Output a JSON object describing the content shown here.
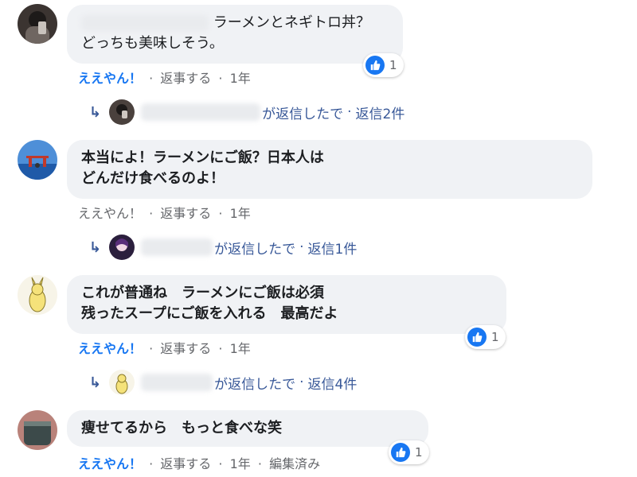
{
  "comments": [
    {
      "lines": [
        "ラーメンとネギトロ丼？",
        "どっちも美味しそう。"
      ],
      "actions": {
        "like": "ええやん！",
        "reply": "返事する",
        "time": "1年"
      },
      "reaction_count": "1",
      "replies": {
        "text": "が返信したで",
        "count": "返信2件"
      }
    },
    {
      "lines": [
        "本当によ！ラーメンにご飯？日本人は",
        "どんだけ食べるのよ！"
      ],
      "actions": {
        "like": "ええやん！",
        "reply": "返事する",
        "time": "1年"
      },
      "replies": {
        "text": "が返信したで",
        "count": "返信1件"
      }
    },
    {
      "lines": [
        "これが普通ね　ラーメンにご飯は必須",
        "残ったスープにご飯を入れる　最高だよ"
      ],
      "actions": {
        "like": "ええやん！",
        "reply": "返事する",
        "time": "1年"
      },
      "reaction_count": "1",
      "replies": {
        "text": "が返信したで",
        "count": "返信4件"
      }
    },
    {
      "lines": [
        "痩せてるから　もっと食べな笑"
      ],
      "actions": {
        "like": "ええやん！",
        "reply": "返事する",
        "time": "1年",
        "edited": "編集済み"
      },
      "reaction_count": "1"
    }
  ],
  "separator": "·",
  "icons": {
    "like": "thumbs-up-icon",
    "reply_arrow": "reply-arrow-icon"
  },
  "colors": {
    "like_blue": "#1877f2",
    "link_blue": "#385898",
    "bubble_bg": "#f0f2f5",
    "meta_gray": "#65676b"
  }
}
